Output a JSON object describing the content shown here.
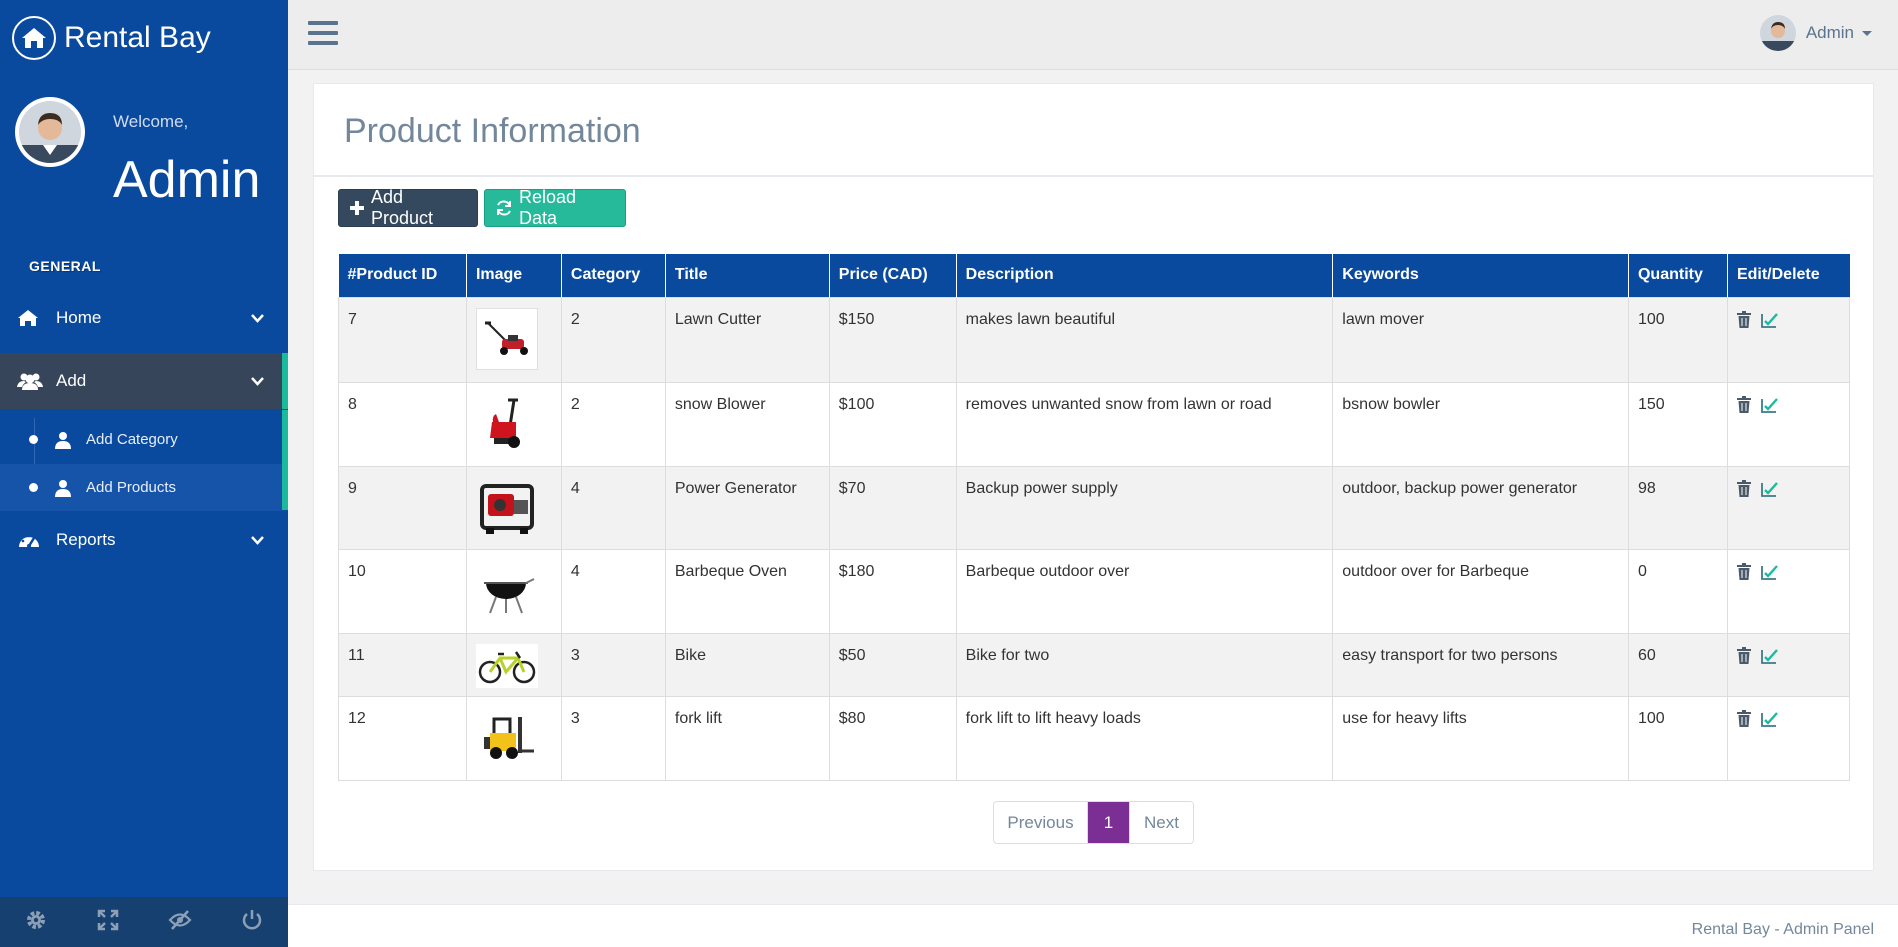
{
  "brand": {
    "title": "Rental Bay"
  },
  "profile": {
    "welcome": "Welcome,",
    "name": "Admin"
  },
  "sidebar": {
    "section_title": "GENERAL",
    "menu": [
      {
        "label": "Home",
        "icon": "home-icon"
      },
      {
        "label": "Add",
        "icon": "users-icon"
      },
      {
        "label": "Reports",
        "icon": "dashboard-icon"
      }
    ],
    "submenu": [
      {
        "label": "Add Category",
        "icon": "user-icon"
      },
      {
        "label": "Add Products",
        "icon": "user-icon"
      }
    ],
    "footer_icons": [
      "settings-icon",
      "fullscreen-icon",
      "eye-slash-icon",
      "power-icon"
    ]
  },
  "topbar": {
    "user_name": "Admin"
  },
  "page": {
    "title": "Product Information",
    "add_button": "Add Product",
    "reload_button": "Reload Data"
  },
  "table": {
    "headers": [
      "#Product ID",
      "Image",
      "Category",
      "Title",
      "Price (CAD)",
      "Description",
      "Keywords",
      "Quantity",
      "Edit/Delete"
    ],
    "rows": [
      {
        "id": "7",
        "image": "lawn-mower-image",
        "category": "2",
        "title": "Lawn Cutter",
        "price": "$150",
        "description": "makes lawn beautiful",
        "keywords": "lawn mover",
        "quantity": "100"
      },
      {
        "id": "8",
        "image": "snow-blower-image",
        "category": "2",
        "title": "snow Blower",
        "price": "$100",
        "description": "removes unwanted snow from lawn or road",
        "keywords": "bsnow bowler",
        "quantity": "150"
      },
      {
        "id": "9",
        "image": "power-generator-image",
        "category": "4",
        "title": "Power Generator",
        "price": "$70",
        "description": "Backup power supply",
        "keywords": "outdoor, backup power generator",
        "quantity": "98"
      },
      {
        "id": "10",
        "image": "barbeque-grill-image",
        "category": "4",
        "title": "Barbeque Oven",
        "price": "$180",
        "description": "Barbeque outdoor over",
        "keywords": "outdoor over for Barbeque",
        "quantity": "0"
      },
      {
        "id": "11",
        "image": "bicycle-image",
        "category": "3",
        "title": "Bike",
        "price": "$50",
        "description": "Bike for two",
        "keywords": "easy transport for two persons",
        "quantity": "60"
      },
      {
        "id": "12",
        "image": "forklift-image",
        "category": "3",
        "title": "fork lift",
        "price": "$80",
        "description": "fork lift to lift heavy loads",
        "keywords": "use for heavy lifts",
        "quantity": "100"
      }
    ]
  },
  "pagination": {
    "previous": "Previous",
    "current": "1",
    "next": "Next"
  },
  "footer": {
    "text": "Rental Bay - Admin Panel"
  },
  "colors": {
    "sidebar": "#0a4a9e",
    "accent": "#1abb9c",
    "table_header": "#0a4a9e",
    "pager_active": "#7b2f95",
    "add_button": "#34495e",
    "reload_button": "#26b99a"
  }
}
